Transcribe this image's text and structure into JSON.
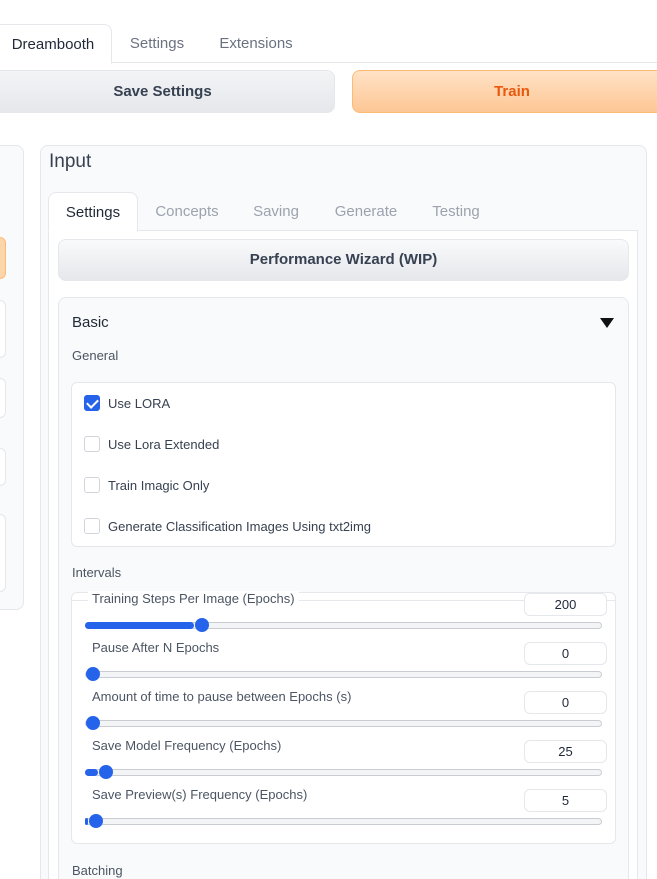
{
  "top_tabs": [
    "Dreambooth",
    "Settings",
    "Extensions"
  ],
  "actions": {
    "save": "Save Settings",
    "train": "Train"
  },
  "input": {
    "title": "Input",
    "tabs": [
      "Settings",
      "Concepts",
      "Saving",
      "Generate",
      "Testing"
    ],
    "performance_wizard": "Performance Wizard (WIP)",
    "basic": {
      "label": "Basic",
      "general_label": "General",
      "checkboxes": [
        {
          "label": "Use LORA",
          "checked": true
        },
        {
          "label": "Use Lora Extended",
          "checked": false
        },
        {
          "label": "Train Imagic Only",
          "checked": false
        },
        {
          "label": "Generate Classification Images Using txt2img",
          "checked": false
        }
      ],
      "intervals_label": "Intervals",
      "sliders": [
        {
          "label": "Training Steps Per Image (Epochs)",
          "value": "200",
          "fraction": 0.21
        },
        {
          "label": "Pause After N Epochs",
          "value": "0",
          "fraction": 0.0
        },
        {
          "label": "Amount of time to pause between Epochs (s)",
          "value": "0",
          "fraction": 0.0
        },
        {
          "label": "Save Model Frequency (Epochs)",
          "value": "25",
          "fraction": 0.025
        },
        {
          "label": "Save Preview(s) Frequency (Epochs)",
          "value": "5",
          "fraction": 0.005
        }
      ],
      "batching_label": "Batching"
    }
  },
  "colors": {
    "accent": "#2563eb",
    "train_text": "#ea580c"
  }
}
